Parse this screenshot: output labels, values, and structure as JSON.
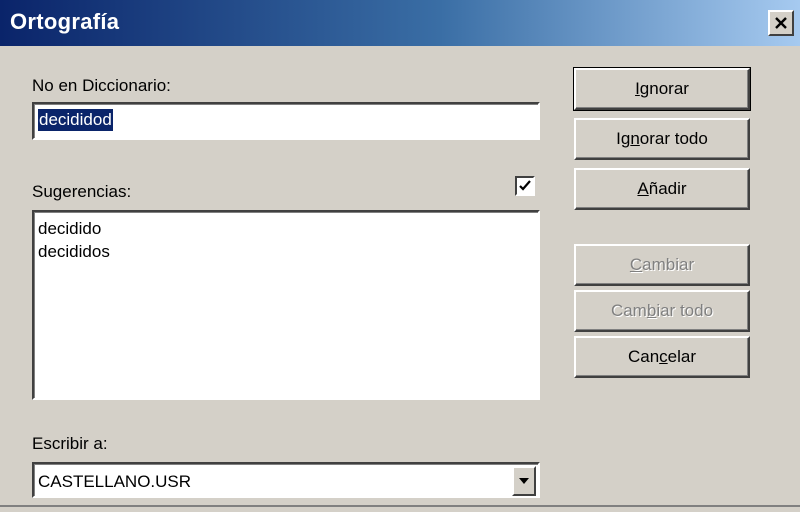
{
  "window": {
    "title": "Ortografía",
    "close_icon": "close-icon"
  },
  "not_in_dictionary": {
    "label": "No en Diccionario:",
    "value": "decididod"
  },
  "suggestions": {
    "label": "Sugerencias:",
    "checkbox_checked": true,
    "items": [
      "decidido",
      "decididos"
    ]
  },
  "write_to": {
    "label": "Escribir a:",
    "value": "CASTELLANO.USR"
  },
  "buttons": {
    "ignore": {
      "pre": "",
      "key": "I",
      "post": "gnorar",
      "enabled": true
    },
    "ignore_all": {
      "pre": "Ig",
      "key": "n",
      "post": "orar todo",
      "enabled": true
    },
    "add": {
      "pre": "",
      "key": "A",
      "post": "ñadir",
      "enabled": true
    },
    "change": {
      "pre": "",
      "key": "C",
      "post": "ambiar",
      "enabled": false
    },
    "change_all": {
      "pre": "Cam",
      "key": "b",
      "post": "iar todo",
      "enabled": false
    },
    "cancel": {
      "pre": "Can",
      "key": "c",
      "post": "elar",
      "enabled": true
    }
  },
  "colors": {
    "face": "#d4d0c8",
    "title_start": "#0a246a",
    "title_end": "#a6caf0",
    "selection": "#0a246a",
    "disabled_text": "#808080"
  }
}
